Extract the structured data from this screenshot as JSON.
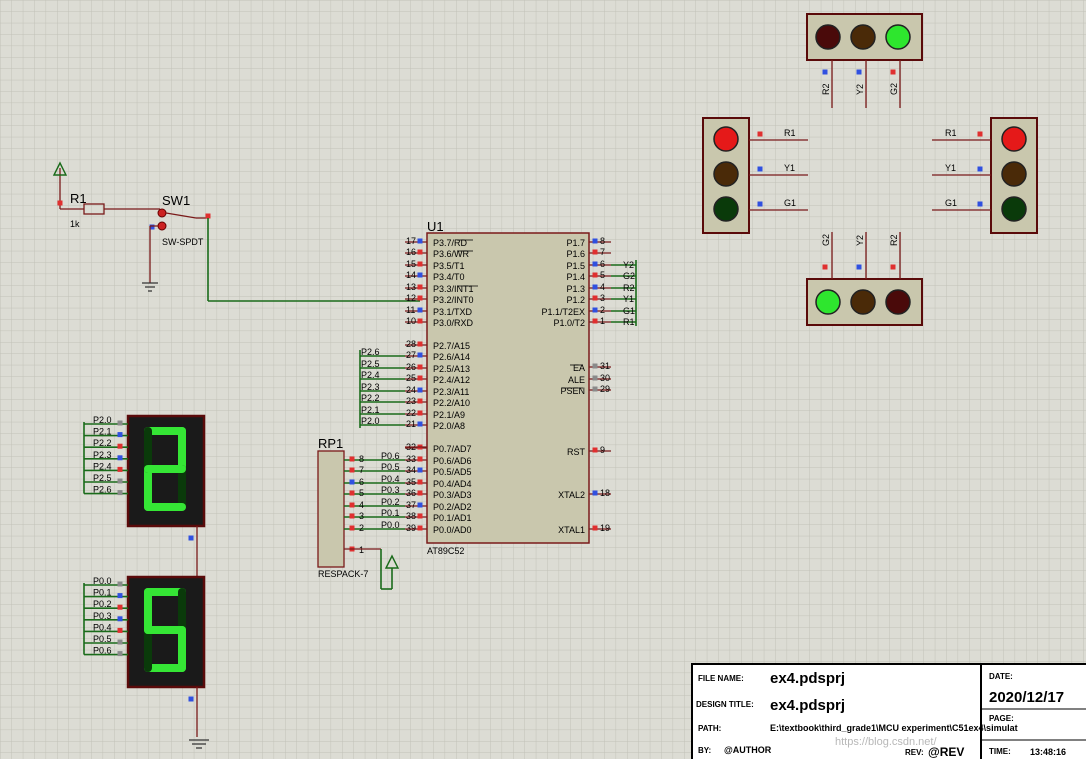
{
  "components": {
    "r1": {
      "ref": "R1",
      "value": "1k"
    },
    "sw1": {
      "ref": "SW1",
      "type": "SW-SPDT"
    },
    "u1": {
      "ref": "U1",
      "part": "AT89C52",
      "left_pins": [
        {
          "num": "17",
          "label": "P3.7/RD"
        },
        {
          "num": "16",
          "label": "P3.6/WR"
        },
        {
          "num": "15",
          "label": "P3.5/T1"
        },
        {
          "num": "14",
          "label": "P3.4/T0"
        },
        {
          "num": "13",
          "label": "P3.3/INT1"
        },
        {
          "num": "12",
          "label": "P3.2/INT0"
        },
        {
          "num": "11",
          "label": "P3.1/TXD"
        },
        {
          "num": "10",
          "label": "P3.0/RXD"
        },
        {
          "num": "28",
          "label": "P2.7/A15"
        },
        {
          "num": "27",
          "label": "P2.6/A14"
        },
        {
          "num": "26",
          "label": "P2.5/A13"
        },
        {
          "num": "25",
          "label": "P2.4/A12"
        },
        {
          "num": "24",
          "label": "P2.3/A11"
        },
        {
          "num": "23",
          "label": "P2.2/A10"
        },
        {
          "num": "22",
          "label": "P2.1/A9"
        },
        {
          "num": "21",
          "label": "P2.0/A8"
        },
        {
          "num": "32",
          "label": "P0.7/AD7"
        },
        {
          "num": "33",
          "label": "P0.6/AD6"
        },
        {
          "num": "34",
          "label": "P0.5/AD5"
        },
        {
          "num": "35",
          "label": "P0.4/AD4"
        },
        {
          "num": "36",
          "label": "P0.3/AD3"
        },
        {
          "num": "37",
          "label": "P0.2/AD2"
        },
        {
          "num": "38",
          "label": "P0.1/AD1"
        },
        {
          "num": "39",
          "label": "P0.0/AD0"
        }
      ],
      "right_pins": [
        {
          "num": "8",
          "label": "P1.7"
        },
        {
          "num": "7",
          "label": "P1.6"
        },
        {
          "num": "6",
          "label": "P1.5"
        },
        {
          "num": "5",
          "label": "P1.4"
        },
        {
          "num": "4",
          "label": "P1.3"
        },
        {
          "num": "3",
          "label": "P1.2"
        },
        {
          "num": "2",
          "label": "P1.1/T2EX"
        },
        {
          "num": "1",
          "label": "P1.0/T2"
        },
        {
          "num": "31",
          "label": "EA"
        },
        {
          "num": "30",
          "label": "ALE"
        },
        {
          "num": "29",
          "label": "PSEN"
        },
        {
          "num": "9",
          "label": "RST"
        },
        {
          "num": "18",
          "label": "XTAL2"
        },
        {
          "num": "19",
          "label": "XTAL1"
        }
      ],
      "p1_nets": [
        "Y2",
        "G2",
        "R2",
        "Y1",
        "G1",
        "R1"
      ],
      "p2_nets": [
        "P2.6",
        "P2.5",
        "P2.4",
        "P2.3",
        "P2.2",
        "P2.1",
        "P2.0"
      ],
      "p0_nets": [
        "P0.6",
        "P0.5",
        "P0.4",
        "P0.3",
        "P0.2",
        "P0.1",
        "P0.0"
      ]
    },
    "rp1": {
      "ref": "RP1",
      "type": "RESPACK-7",
      "pins": [
        "8",
        "7",
        "6",
        "5",
        "4",
        "3",
        "2",
        "1"
      ],
      "nets": [
        "P0.6",
        "P0.5",
        "P0.4",
        "P0.3",
        "P0.2",
        "P0.1",
        "P0.0"
      ]
    },
    "display_top": {
      "digit": "2",
      "nets": [
        "P2.0",
        "P2.1",
        "P2.2",
        "P2.3",
        "P2.4",
        "P2.5",
        "P2.6"
      ]
    },
    "display_bottom": {
      "digit": "5",
      "nets": [
        "P0.0",
        "P0.1",
        "P0.2",
        "P0.3",
        "P0.4",
        "P0.5",
        "P0.6"
      ]
    },
    "lights": {
      "north": {
        "labels": [
          "R2",
          "Y2",
          "G2"
        ],
        "lit": "green"
      },
      "south": {
        "labels": [
          "G2",
          "Y2",
          "R2"
        ],
        "lit": "green"
      },
      "west": {
        "labels": [
          "R1",
          "Y1",
          "G1"
        ],
        "lit": "red"
      },
      "east": {
        "labels": [
          "R1",
          "Y1",
          "G1"
        ],
        "lit": "red"
      }
    },
    "colors": {
      "red_on": "#e51919",
      "green_on": "#2ee62e",
      "red_off": "#4a0a0a",
      "yellow_off": "#4a2a08",
      "green_off": "#0a3a0a",
      "wire": "#1a6b1a",
      "body": "#c9c7ad",
      "outline": "#7a1a1a",
      "seg_on": "#35e635",
      "seg_off": "#0a3a0a"
    }
  },
  "title_block": {
    "file_name_label": "FILE NAME:",
    "file_name": "ex4.pdsprj",
    "design_title_label": "DESIGN TITLE:",
    "design_title": "ex4.pdsprj",
    "path_label": "PATH:",
    "path": "E:\\textbook\\third_grade1\\MCU experiment\\C51ex4\\simulat",
    "by_label": "BY:",
    "by": "@AUTHOR",
    "rev_label": "REV:",
    "rev": "@REV",
    "date_label": "DATE:",
    "date": "2020/12/17",
    "page_label": "PAGE:",
    "time_label": "TIME:",
    "time": "13:48:16",
    "watermark": "https://blog.csdn.net/"
  }
}
